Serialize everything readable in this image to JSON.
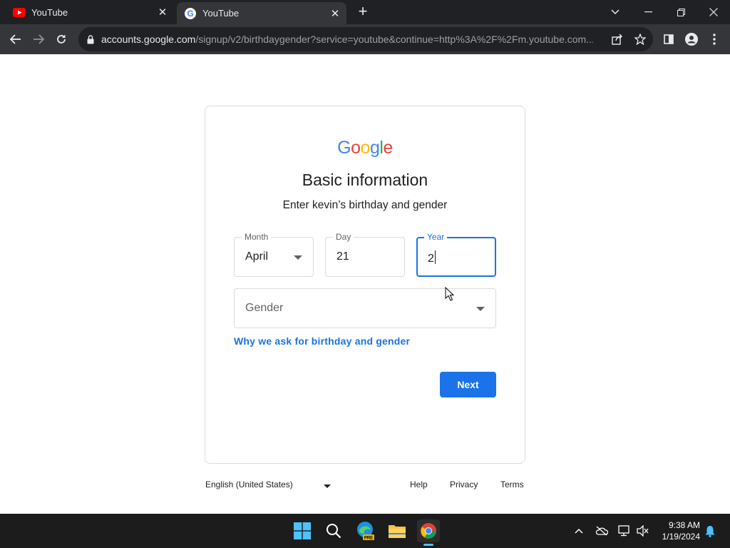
{
  "browser": {
    "tabs": [
      {
        "title": "YouTube",
        "icon": "youtube-icon",
        "active": false
      },
      {
        "title": "YouTube",
        "icon": "google-g-icon",
        "active": true
      }
    ],
    "url_host": "accounts.google.com",
    "url_path": "/signup/v2/birthdaygender?service=youtube&continue=http%3A%2F%2Fm.youtube.com..."
  },
  "page": {
    "logo_text": "Google",
    "heading": "Basic information",
    "subheading": "Enter kevin’s birthday and gender",
    "month": {
      "label": "Month",
      "value": "April"
    },
    "day": {
      "label": "Day",
      "value": "21"
    },
    "year": {
      "label": "Year",
      "value": "2"
    },
    "gender": {
      "placeholder": "Gender"
    },
    "why_link": "Why we ask for birthday and gender",
    "next_label": "Next"
  },
  "footer": {
    "language": "English (United States)",
    "help": "Help",
    "privacy": "Privacy",
    "terms": "Terms"
  },
  "taskbar": {
    "time": "9:38 AM",
    "date": "1/19/2024",
    "edge_badge": "PRE"
  },
  "colors": {
    "accent": "#1a73e8",
    "google_blue": "#4285f4",
    "google_red": "#ea4335",
    "google_yellow": "#fbbc05",
    "google_green": "#34a853"
  }
}
